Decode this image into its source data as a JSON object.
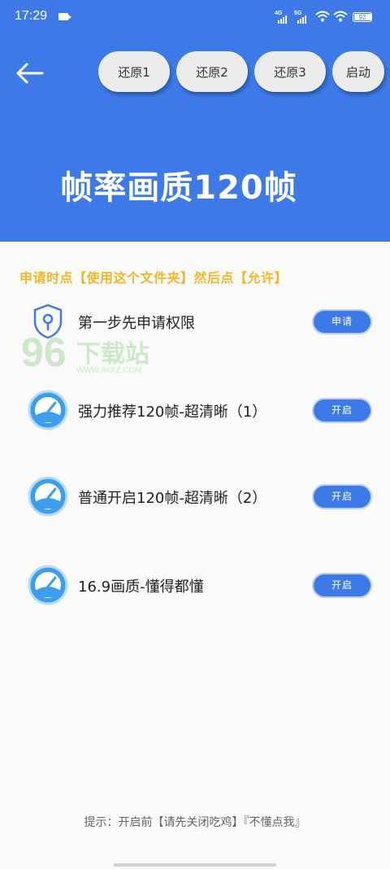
{
  "status_bar": {
    "time": "17:29",
    "signal1_tag": "4G",
    "signal2_tag": "5G",
    "battery": "92"
  },
  "header": {
    "back_icon": "arrow-left-icon",
    "buttons": [
      {
        "label": "还原1"
      },
      {
        "label": "还原2"
      },
      {
        "label": "还原3"
      },
      {
        "label": "启动"
      }
    ],
    "title": "帧率画质120帧"
  },
  "notice": "申请时点【使用这个文件夹】然后点【允许】",
  "items": [
    {
      "icon": "shield-key-icon",
      "label": "第一步先申请权限",
      "action": "申请"
    },
    {
      "icon": "speedometer-icon",
      "label": "强力推荐120帧-超清晰（1）",
      "action": "开启"
    },
    {
      "icon": "speedometer-icon",
      "label": "普通开启120帧-超清晰（2）",
      "action": "开启"
    },
    {
      "icon": "speedometer-icon",
      "label": "16.9画质-懂得都懂",
      "action": "开启"
    }
  ],
  "watermark": {
    "number": "96",
    "text": "下载站",
    "url": "WWW.96XZ.COM"
  },
  "tip": "提示：开启前【请先关闭吃鸡】『不懂点我』",
  "colors": {
    "primary": "#3d7ae8",
    "notice": "#f2b629",
    "pill": "#ebebeb"
  }
}
